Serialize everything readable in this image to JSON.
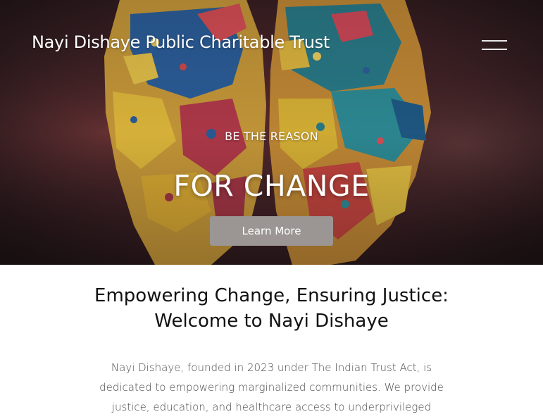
{
  "header": {
    "site_title": "Nayi Dishaye Public Charitable Trust",
    "menu_icon": "hamburger-menu-icon"
  },
  "hero": {
    "kicker": "BE THE REASON",
    "headline": "FOR CHANGE",
    "cta_label": "Learn More"
  },
  "intro": {
    "heading_lines": [
      "Empowering Change, Ensuring Justice:",
      "Welcome to Nayi Dishaye"
    ],
    "body_lines": [
      "Nayi Dishaye, founded in 2023 under The Indian Trust Act, is",
      "dedicated to empowering marginalized communities. We provide",
      "justice, education, and healthcare access to underprivileged"
    ]
  },
  "colors": {
    "cta_background": "#9b9693",
    "hero_text": "#ffffff",
    "heading_text": "#111111",
    "body_text": "#4a4a4a"
  }
}
